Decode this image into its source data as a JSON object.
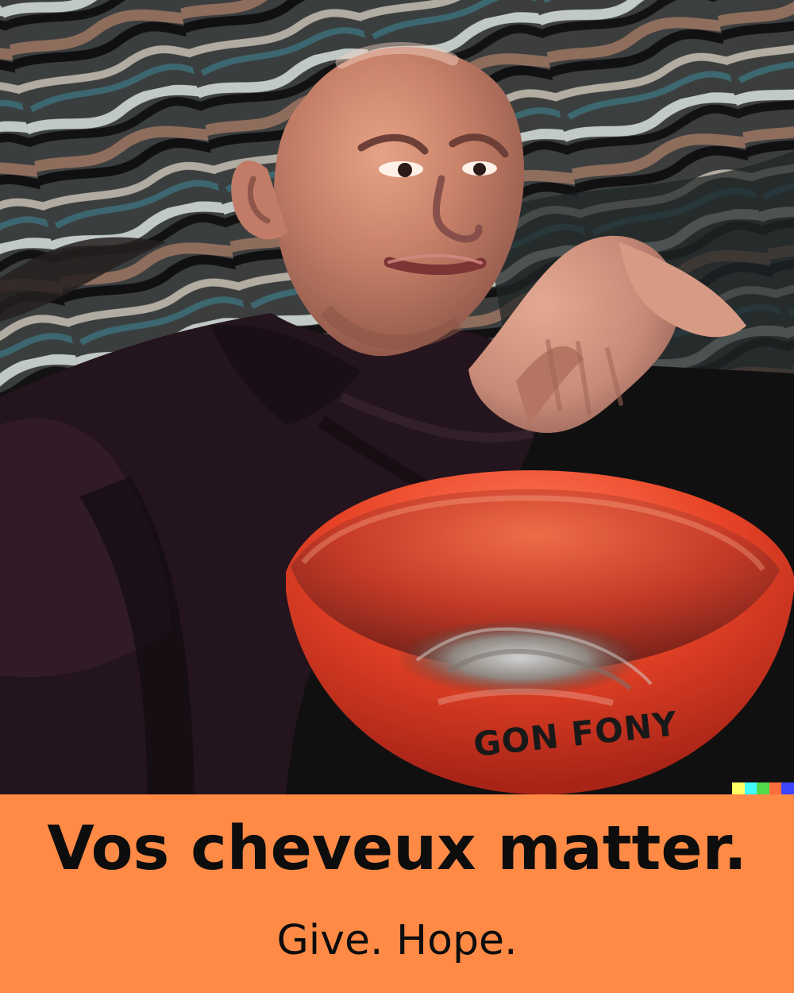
{
  "photo": {
    "subject": "man-with-orange-bowl",
    "bowl_text": "GON FONY",
    "colors": {
      "bowl": "#f34b2b",
      "shirt": "#22131d",
      "background": "#2b2624",
      "banner": "#ff8a45"
    }
  },
  "caption": {
    "headline": "Vos cheveux matter.",
    "tagline": "Give. Hope."
  }
}
